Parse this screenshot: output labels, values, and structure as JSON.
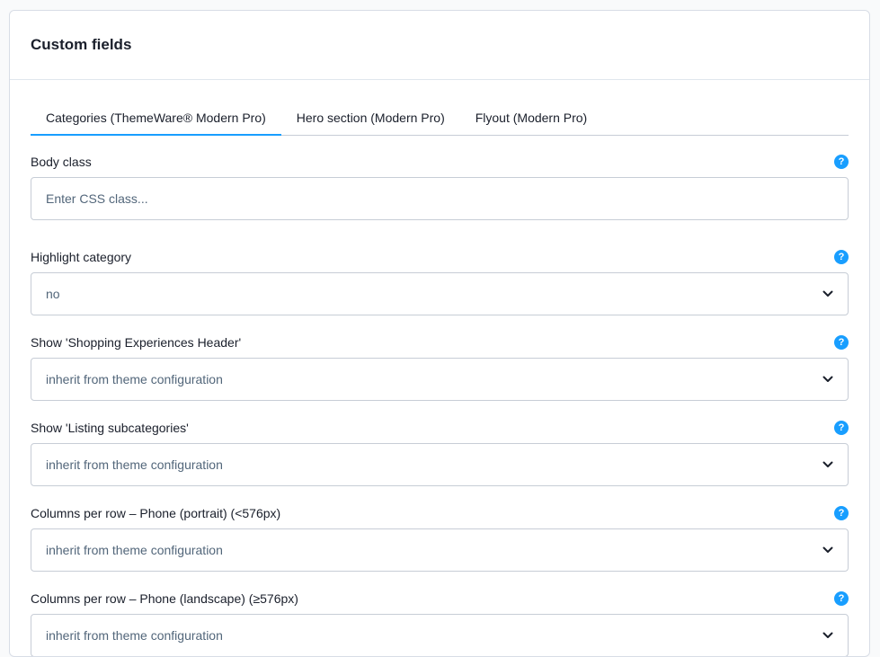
{
  "card": {
    "title": "Custom fields"
  },
  "tabs": [
    {
      "label": "Categories (ThemeWare® Modern Pro)",
      "active": true
    },
    {
      "label": "Hero section (Modern Pro)",
      "active": false
    },
    {
      "label": "Flyout (Modern Pro)",
      "active": false
    }
  ],
  "fields": {
    "body_class": {
      "label": "Body class",
      "placeholder": "Enter CSS class...",
      "value": ""
    },
    "highlight_category": {
      "label": "Highlight category",
      "value": "no"
    },
    "shopping_experiences_header": {
      "label": "Show 'Shopping Experiences Header'",
      "value": "inherit from theme configuration"
    },
    "listing_subcategories": {
      "label": "Show 'Listing subcategories'",
      "value": "inherit from theme configuration"
    },
    "columns_phone_portrait": {
      "label": "Columns per row – Phone (portrait) (<576px)",
      "value": "inherit from theme configuration"
    },
    "columns_phone_landscape": {
      "label": "Columns per row – Phone (landscape) (≥576px)",
      "value": "inherit from theme configuration"
    }
  },
  "help_glyph": "?",
  "colors": {
    "accent": "#189eff",
    "border": "#c7cdd6",
    "text": "#1a1f2b",
    "muted_text": "#52667a"
  },
  "icons": {
    "help": "help-icon",
    "dropdown": "chevron-down-icon"
  }
}
